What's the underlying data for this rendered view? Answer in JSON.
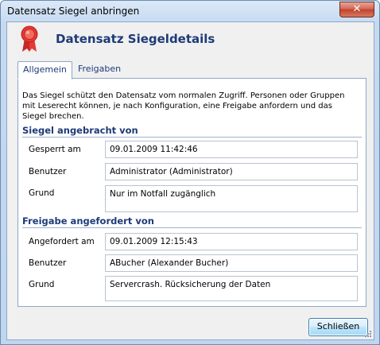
{
  "window": {
    "title": "Datensatz Siegel anbringen"
  },
  "header": {
    "title": "Datensatz Siegeldetails",
    "icon": "award-ribbon-icon"
  },
  "tabs": [
    {
      "label": "Allgemein",
      "active": true
    },
    {
      "label": "Freigaben",
      "active": false
    }
  ],
  "general": {
    "description": "Das Siegel schützt den Datensatz vom normalen Zugriff. Personen oder Gruppen mit Leserecht können, je nach Konfiguration, eine Freigabe anfordern und das Siegel brechen.",
    "sealed_section": {
      "title": "Siegel angebracht von",
      "locked_at_label": "Gesperrt am",
      "locked_at_value": "09.01.2009 11:42:46",
      "user_label": "Benutzer",
      "user_value": "Administrator (Administrator)",
      "reason_label": "Grund",
      "reason_value": "Nur im Notfall zugänglich"
    },
    "release_section": {
      "title": "Freigabe angefordert von",
      "requested_at_label": "Angefordert am",
      "requested_at_value": "09.01.2009 12:15:43",
      "user_label": "Benutzer",
      "user_value": "ABucher (Alexander Bucher)",
      "reason_label": "Grund",
      "reason_value": "Servercrash. Rücksicherung der Daten"
    }
  },
  "footer": {
    "close_label": "Schließen"
  },
  "colors": {
    "accent": "#1e3a78",
    "close_button": "#c2412c",
    "ribbon": "#d32f2f"
  }
}
